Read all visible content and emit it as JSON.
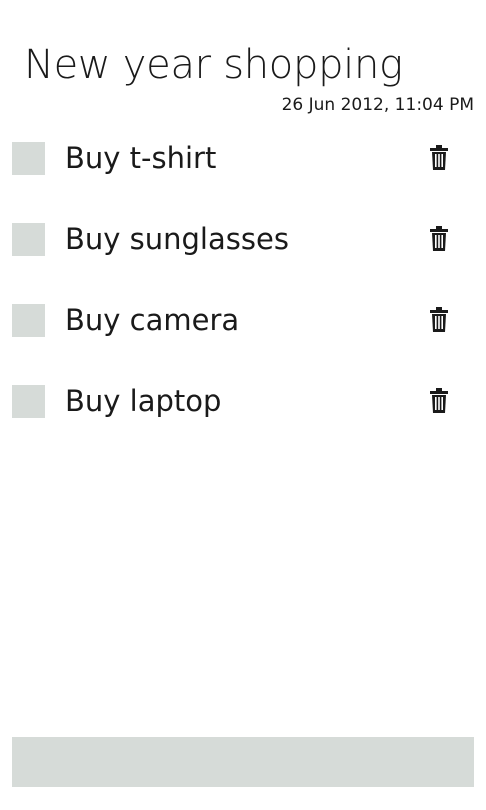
{
  "header": {
    "title": "New year shopping",
    "timestamp": "26 Jun 2012, 11:04 PM"
  },
  "tasks": [
    {
      "label": "Buy t-shirt",
      "checked": false,
      "action_icon": "trash-icon"
    },
    {
      "label": "Buy sunglasses",
      "checked": false,
      "action_icon": "trash-icon"
    },
    {
      "label": "Buy camera",
      "checked": false,
      "action_icon": "trash-icon"
    },
    {
      "label": "Buy laptop",
      "checked": false,
      "action_icon": "trash-icon"
    }
  ],
  "colors": {
    "background": "#ffffff",
    "text": "#1a1a1a",
    "checkbox_fill": "#d6dbd8",
    "bottom_bar": "#d6dbd8"
  }
}
